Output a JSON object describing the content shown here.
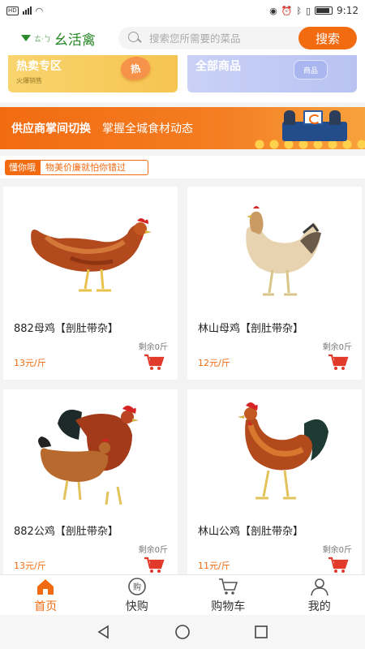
{
  "status_bar": {
    "time": "9:12",
    "network": "HD",
    "signal": "⁴ᴳ"
  },
  "header": {
    "logo_text": "幺活禽",
    "logo_small": "ㄊ·ㄅ",
    "search_placeholder": "搜索您所需要的菜品",
    "search_button": "搜索"
  },
  "promo": {
    "hot": {
      "title": "热卖专区",
      "subtitle": "火爆销售",
      "badge": "热"
    },
    "all": {
      "title": "全部商品",
      "badge": "商品"
    }
  },
  "banner": {
    "title": "供应商掌间切换",
    "subtitle": "掌握全城食材动态"
  },
  "ticker": {
    "tag": "懂你哦",
    "text": "物美价廉就怕你错过"
  },
  "products": [
    {
      "name": "882母鸡【剖肚带杂】",
      "stock": "剩余0斤",
      "price": "13元/斤",
      "image": "hen-red"
    },
    {
      "name": "林山母鸡【剖肚带杂】",
      "stock": "剩余0斤",
      "price": "12元/斤",
      "image": "hen-pale"
    },
    {
      "name": "882公鸡【剖肚带杂】",
      "stock": "剩余0斤",
      "price": "13元/斤",
      "image": "rooster-group"
    },
    {
      "name": "林山公鸡【剖肚带杂】",
      "stock": "剩余0斤",
      "price": "11元/斤",
      "image": "rooster"
    }
  ],
  "tabs": [
    {
      "label": "首页",
      "icon": "home-icon",
      "active": true
    },
    {
      "label": "快购",
      "icon": "quick-buy-icon",
      "active": false
    },
    {
      "label": "购物车",
      "icon": "cart-icon",
      "active": false
    },
    {
      "label": "我的",
      "icon": "user-icon",
      "active": false
    }
  ],
  "colors": {
    "accent": "#f26b11",
    "brand_green": "#2a8a2a"
  }
}
